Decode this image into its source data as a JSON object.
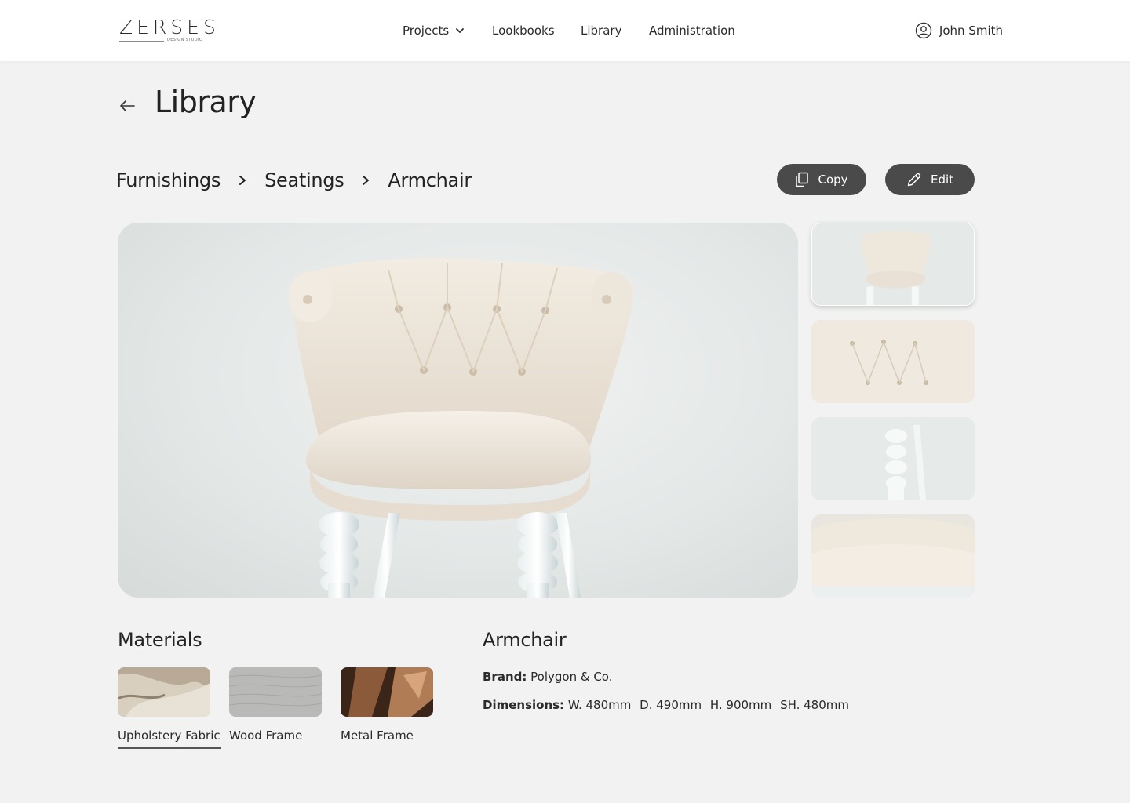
{
  "app": {
    "logo_text": "ZERSES",
    "logo_subtitle": "DESIGN STUDIO"
  },
  "nav": {
    "items": [
      {
        "label": "Projects",
        "has_dropdown": true
      },
      {
        "label": "Lookbooks"
      },
      {
        "label": "Library"
      },
      {
        "label": "Administration"
      }
    ]
  },
  "user": {
    "name": "John Smith",
    "icon": "user-circle-icon"
  },
  "page": {
    "title": "Library",
    "back_icon": "arrow-left-icon"
  },
  "breadcrumb": {
    "items": [
      "Furnishings",
      "Seatings",
      "Armchair"
    ],
    "separator_icon": "chevron-right-icon"
  },
  "actions": {
    "copy_label": "Copy",
    "copy_icon": "copy-icon",
    "edit_label": "Edit",
    "edit_icon": "pencil-icon"
  },
  "gallery": {
    "main_alt": "white tufted armchair",
    "thumbnails": [
      {
        "view": "full chair",
        "active": true
      },
      {
        "view": "backrest detail"
      },
      {
        "view": "leg detail"
      },
      {
        "view": "seat detail"
      }
    ]
  },
  "materials": {
    "title": "Materials",
    "items": [
      {
        "label": "Upholstery Fabric",
        "active": true
      },
      {
        "label": "Wood Frame"
      },
      {
        "label": "Metal Frame"
      }
    ]
  },
  "product": {
    "name": "Armchair",
    "brand_label": "Brand:",
    "brand_value": "Polygon & Co.",
    "dimensions_label": "Dimensions:",
    "dimensions": [
      "W. 480mm",
      "D. 490mm",
      "H. 900mm",
      "SH. 480mm"
    ]
  },
  "colors": {
    "background": "#f1f2f1",
    "header": "#ffffff",
    "button": "#4a4a4a",
    "text": "#222222"
  }
}
